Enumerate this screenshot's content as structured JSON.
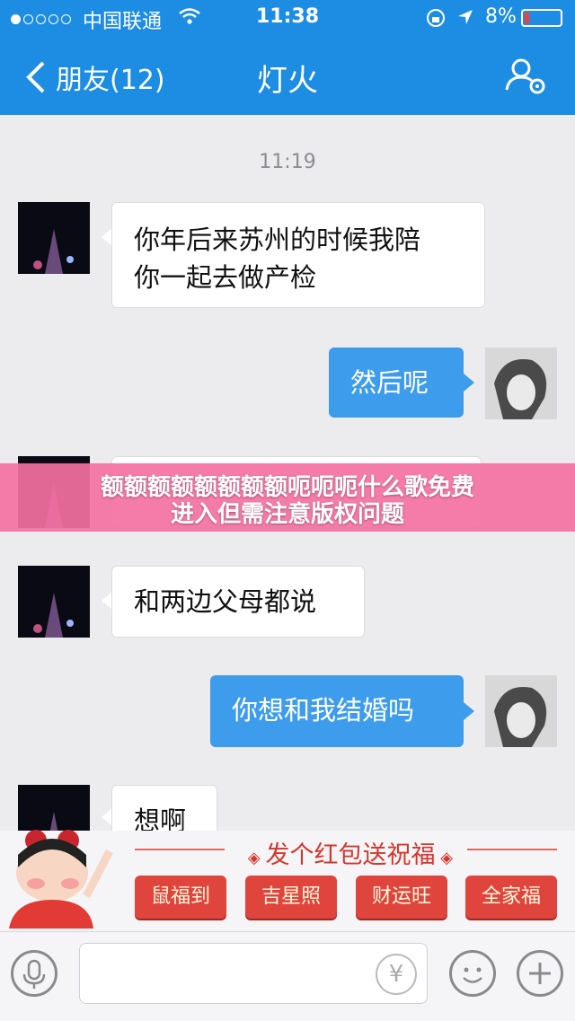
{
  "status_bar": {
    "carrier": "中国联通",
    "time": "11:38",
    "battery": "8%"
  },
  "nav": {
    "back_label": "朋友(12)",
    "title": "灯火"
  },
  "chat": {
    "timestamp": "11:19",
    "messages": [
      {
        "side": "left",
        "line1": "你年后来苏州的时候我陪",
        "line2": "你一起去做产检"
      },
      {
        "side": "right",
        "text": "然后呢"
      },
      {
        "side": "left",
        "text": "和两边父母都说"
      },
      {
        "side": "right",
        "text": "你想和我结婚吗"
      },
      {
        "side": "left",
        "text": "想啊"
      }
    ]
  },
  "overlay": {
    "line1": "额额额额额额额额呃呃呃什么歌免费",
    "line2": "进入但需注意版权问题"
  },
  "red_packet": {
    "title": "发个红包送祝福",
    "buttons": [
      "鼠福到",
      "吉星照",
      "财运旺",
      "全家福"
    ]
  },
  "colors": {
    "nav_blue": "#1d8de3",
    "bubble_blue": "#3d9cec",
    "overlay_pink": "#f470a1",
    "packet_red": "#e0453d"
  },
  "icons": [
    "back-chevron-icon",
    "profile-settings-icon",
    "microphone-icon",
    "yuan-icon",
    "emoji-icon",
    "plus-icon"
  ]
}
